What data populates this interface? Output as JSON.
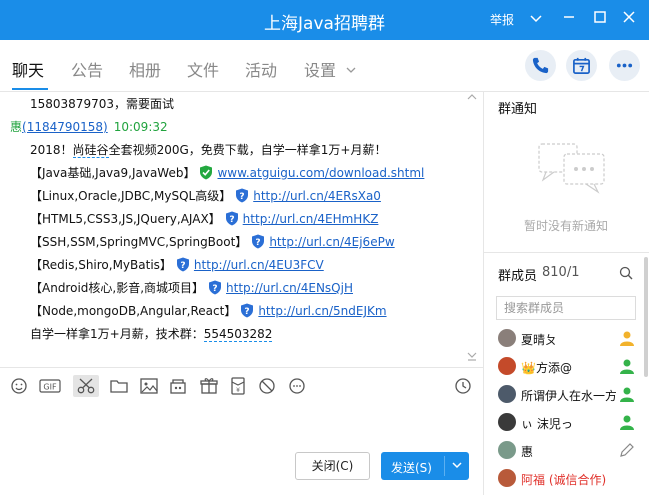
{
  "window": {
    "title": "上海Java招聘群",
    "report_label": "举报"
  },
  "tabs": [
    {
      "label": "聊天"
    },
    {
      "label": "公告"
    },
    {
      "label": "相册"
    },
    {
      "label": "文件"
    },
    {
      "label": "活动"
    },
    {
      "label": "设置"
    }
  ],
  "chat": {
    "top_line": "15803879703，需要面试",
    "sender_name": "惠",
    "sender_id": "(1184790158)",
    "sender_time": "10:09:32",
    "intro_prefix": "2018！",
    "intro_dashed": "尚硅谷",
    "intro_suffix": "全套视频200G，免费下载，自学一样拿1万+月薪！",
    "lines": [
      {
        "text": "【Java基础,Java9,JavaWeb】",
        "url": "www.atguigu.com/download.shtml",
        "verified": true
      },
      {
        "text": "【Linux,Oracle,JDBC,MySQL高级】",
        "url": "http://url.cn/4ERsXa0",
        "verified": false
      },
      {
        "text": "【HTML5,CSS3,JS,JQuery,AJAX】",
        "url": "http://url.cn/4EHmHKZ",
        "verified": false
      },
      {
        "text": "【SSH,SSM,SpringMVC,SpringBoot】",
        "url": "http://url.cn/4Ej6ePw",
        "verified": false
      },
      {
        "text": "【Redis,Shiro,MyBatis】",
        "url": "http://url.cn/4EU3FCV",
        "verified": false
      },
      {
        "text": "【Android核心,影音,商城项目】",
        "url": "http://url.cn/4ENsQjH",
        "verified": false
      },
      {
        "text": "【Node,mongoDB,Angular,React】",
        "url": "http://url.cn/5ndEJKm",
        "verified": false
      }
    ],
    "footer_prefix": "自学一样拿1万+月薪，技术群：",
    "footer_group": "554503282"
  },
  "input": {
    "close_label": "关闭(C)",
    "send_label": "发送(S)"
  },
  "notice": {
    "title": "群通知",
    "empty_text": "暂时没有新通知"
  },
  "members": {
    "title": "群成员",
    "count": "810/1",
    "search_placeholder": "搜索群成员",
    "list": [
      {
        "name": "夏晴ㄆ",
        "color": "#111111"
      },
      {
        "name": "👑方添@",
        "color": "#111111"
      },
      {
        "name": "所谓伊人在水一方",
        "color": "#111111"
      },
      {
        "name": "ぃ   沫児っ",
        "color": "#111111"
      },
      {
        "name": "惠",
        "color": "#111111"
      },
      {
        "name": "阿福  (诚信合作)",
        "color": "#e0302a"
      }
    ]
  },
  "colors": {
    "accent": "#1a8de8",
    "link": "#1a62c8",
    "sender": "#21a33e"
  }
}
